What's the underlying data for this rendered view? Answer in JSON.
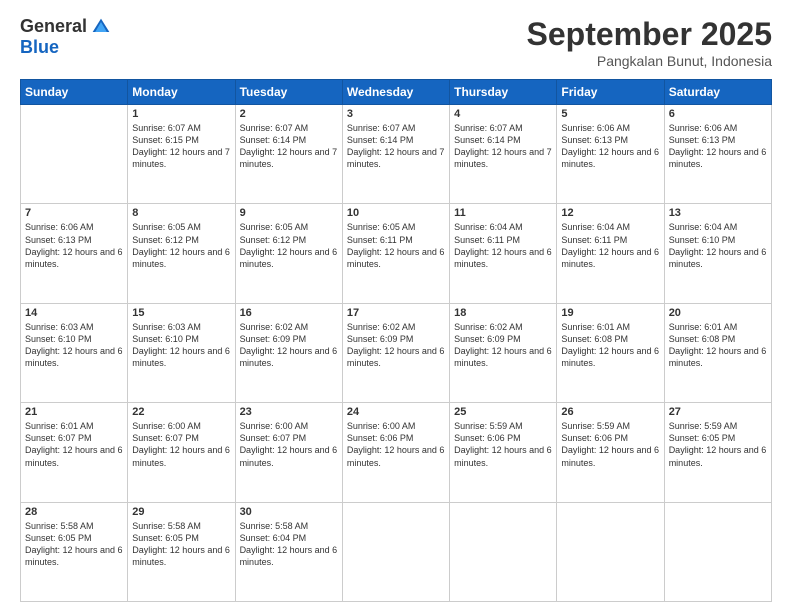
{
  "logo": {
    "general": "General",
    "blue": "Blue"
  },
  "title": "September 2025",
  "location": "Pangkalan Bunut, Indonesia",
  "days_header": [
    "Sunday",
    "Monday",
    "Tuesday",
    "Wednesday",
    "Thursday",
    "Friday",
    "Saturday"
  ],
  "weeks": [
    [
      {
        "num": "",
        "sunrise": "",
        "sunset": "",
        "daylight": ""
      },
      {
        "num": "1",
        "sunrise": "Sunrise: 6:07 AM",
        "sunset": "Sunset: 6:15 PM",
        "daylight": "Daylight: 12 hours and 7 minutes."
      },
      {
        "num": "2",
        "sunrise": "Sunrise: 6:07 AM",
        "sunset": "Sunset: 6:14 PM",
        "daylight": "Daylight: 12 hours and 7 minutes."
      },
      {
        "num": "3",
        "sunrise": "Sunrise: 6:07 AM",
        "sunset": "Sunset: 6:14 PM",
        "daylight": "Daylight: 12 hours and 7 minutes."
      },
      {
        "num": "4",
        "sunrise": "Sunrise: 6:07 AM",
        "sunset": "Sunset: 6:14 PM",
        "daylight": "Daylight: 12 hours and 7 minutes."
      },
      {
        "num": "5",
        "sunrise": "Sunrise: 6:06 AM",
        "sunset": "Sunset: 6:13 PM",
        "daylight": "Daylight: 12 hours and 6 minutes."
      },
      {
        "num": "6",
        "sunrise": "Sunrise: 6:06 AM",
        "sunset": "Sunset: 6:13 PM",
        "daylight": "Daylight: 12 hours and 6 minutes."
      }
    ],
    [
      {
        "num": "7",
        "sunrise": "Sunrise: 6:06 AM",
        "sunset": "Sunset: 6:13 PM",
        "daylight": "Daylight: 12 hours and 6 minutes."
      },
      {
        "num": "8",
        "sunrise": "Sunrise: 6:05 AM",
        "sunset": "Sunset: 6:12 PM",
        "daylight": "Daylight: 12 hours and 6 minutes."
      },
      {
        "num": "9",
        "sunrise": "Sunrise: 6:05 AM",
        "sunset": "Sunset: 6:12 PM",
        "daylight": "Daylight: 12 hours and 6 minutes."
      },
      {
        "num": "10",
        "sunrise": "Sunrise: 6:05 AM",
        "sunset": "Sunset: 6:11 PM",
        "daylight": "Daylight: 12 hours and 6 minutes."
      },
      {
        "num": "11",
        "sunrise": "Sunrise: 6:04 AM",
        "sunset": "Sunset: 6:11 PM",
        "daylight": "Daylight: 12 hours and 6 minutes."
      },
      {
        "num": "12",
        "sunrise": "Sunrise: 6:04 AM",
        "sunset": "Sunset: 6:11 PM",
        "daylight": "Daylight: 12 hours and 6 minutes."
      },
      {
        "num": "13",
        "sunrise": "Sunrise: 6:04 AM",
        "sunset": "Sunset: 6:10 PM",
        "daylight": "Daylight: 12 hours and 6 minutes."
      }
    ],
    [
      {
        "num": "14",
        "sunrise": "Sunrise: 6:03 AM",
        "sunset": "Sunset: 6:10 PM",
        "daylight": "Daylight: 12 hours and 6 minutes."
      },
      {
        "num": "15",
        "sunrise": "Sunrise: 6:03 AM",
        "sunset": "Sunset: 6:10 PM",
        "daylight": "Daylight: 12 hours and 6 minutes."
      },
      {
        "num": "16",
        "sunrise": "Sunrise: 6:02 AM",
        "sunset": "Sunset: 6:09 PM",
        "daylight": "Daylight: 12 hours and 6 minutes."
      },
      {
        "num": "17",
        "sunrise": "Sunrise: 6:02 AM",
        "sunset": "Sunset: 6:09 PM",
        "daylight": "Daylight: 12 hours and 6 minutes."
      },
      {
        "num": "18",
        "sunrise": "Sunrise: 6:02 AM",
        "sunset": "Sunset: 6:09 PM",
        "daylight": "Daylight: 12 hours and 6 minutes."
      },
      {
        "num": "19",
        "sunrise": "Sunrise: 6:01 AM",
        "sunset": "Sunset: 6:08 PM",
        "daylight": "Daylight: 12 hours and 6 minutes."
      },
      {
        "num": "20",
        "sunrise": "Sunrise: 6:01 AM",
        "sunset": "Sunset: 6:08 PM",
        "daylight": "Daylight: 12 hours and 6 minutes."
      }
    ],
    [
      {
        "num": "21",
        "sunrise": "Sunrise: 6:01 AM",
        "sunset": "Sunset: 6:07 PM",
        "daylight": "Daylight: 12 hours and 6 minutes."
      },
      {
        "num": "22",
        "sunrise": "Sunrise: 6:00 AM",
        "sunset": "Sunset: 6:07 PM",
        "daylight": "Daylight: 12 hours and 6 minutes."
      },
      {
        "num": "23",
        "sunrise": "Sunrise: 6:00 AM",
        "sunset": "Sunset: 6:07 PM",
        "daylight": "Daylight: 12 hours and 6 minutes."
      },
      {
        "num": "24",
        "sunrise": "Sunrise: 6:00 AM",
        "sunset": "Sunset: 6:06 PM",
        "daylight": "Daylight: 12 hours and 6 minutes."
      },
      {
        "num": "25",
        "sunrise": "Sunrise: 5:59 AM",
        "sunset": "Sunset: 6:06 PM",
        "daylight": "Daylight: 12 hours and 6 minutes."
      },
      {
        "num": "26",
        "sunrise": "Sunrise: 5:59 AM",
        "sunset": "Sunset: 6:06 PM",
        "daylight": "Daylight: 12 hours and 6 minutes."
      },
      {
        "num": "27",
        "sunrise": "Sunrise: 5:59 AM",
        "sunset": "Sunset: 6:05 PM",
        "daylight": "Daylight: 12 hours and 6 minutes."
      }
    ],
    [
      {
        "num": "28",
        "sunrise": "Sunrise: 5:58 AM",
        "sunset": "Sunset: 6:05 PM",
        "daylight": "Daylight: 12 hours and 6 minutes."
      },
      {
        "num": "29",
        "sunrise": "Sunrise: 5:58 AM",
        "sunset": "Sunset: 6:05 PM",
        "daylight": "Daylight: 12 hours and 6 minutes."
      },
      {
        "num": "30",
        "sunrise": "Sunrise: 5:58 AM",
        "sunset": "Sunset: 6:04 PM",
        "daylight": "Daylight: 12 hours and 6 minutes."
      },
      {
        "num": "",
        "sunrise": "",
        "sunset": "",
        "daylight": ""
      },
      {
        "num": "",
        "sunrise": "",
        "sunset": "",
        "daylight": ""
      },
      {
        "num": "",
        "sunrise": "",
        "sunset": "",
        "daylight": ""
      },
      {
        "num": "",
        "sunrise": "",
        "sunset": "",
        "daylight": ""
      }
    ]
  ]
}
